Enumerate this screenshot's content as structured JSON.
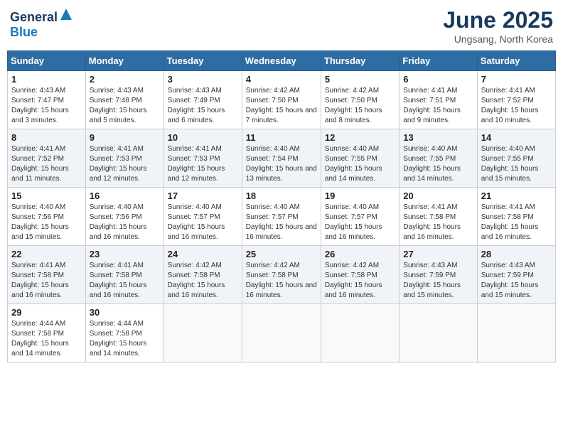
{
  "header": {
    "logo_general": "General",
    "logo_blue": "Blue",
    "month_title": "June 2025",
    "location": "Ungsang, North Korea"
  },
  "days_of_week": [
    "Sunday",
    "Monday",
    "Tuesday",
    "Wednesday",
    "Thursday",
    "Friday",
    "Saturday"
  ],
  "weeks": [
    [
      {
        "day": "1",
        "sunrise": "4:43 AM",
        "sunset": "7:47 PM",
        "daylight": "15 hours and 3 minutes."
      },
      {
        "day": "2",
        "sunrise": "4:43 AM",
        "sunset": "7:48 PM",
        "daylight": "15 hours and 5 minutes."
      },
      {
        "day": "3",
        "sunrise": "4:43 AM",
        "sunset": "7:49 PM",
        "daylight": "15 hours and 6 minutes."
      },
      {
        "day": "4",
        "sunrise": "4:42 AM",
        "sunset": "7:50 PM",
        "daylight": "15 hours and 7 minutes."
      },
      {
        "day": "5",
        "sunrise": "4:42 AM",
        "sunset": "7:50 PM",
        "daylight": "15 hours and 8 minutes."
      },
      {
        "day": "6",
        "sunrise": "4:41 AM",
        "sunset": "7:51 PM",
        "daylight": "15 hours and 9 minutes."
      },
      {
        "day": "7",
        "sunrise": "4:41 AM",
        "sunset": "7:52 PM",
        "daylight": "15 hours and 10 minutes."
      }
    ],
    [
      {
        "day": "8",
        "sunrise": "4:41 AM",
        "sunset": "7:52 PM",
        "daylight": "15 hours and 11 minutes."
      },
      {
        "day": "9",
        "sunrise": "4:41 AM",
        "sunset": "7:53 PM",
        "daylight": "15 hours and 12 minutes."
      },
      {
        "day": "10",
        "sunrise": "4:41 AM",
        "sunset": "7:53 PM",
        "daylight": "15 hours and 12 minutes."
      },
      {
        "day": "11",
        "sunrise": "4:40 AM",
        "sunset": "7:54 PM",
        "daylight": "15 hours and 13 minutes."
      },
      {
        "day": "12",
        "sunrise": "4:40 AM",
        "sunset": "7:55 PM",
        "daylight": "15 hours and 14 minutes."
      },
      {
        "day": "13",
        "sunrise": "4:40 AM",
        "sunset": "7:55 PM",
        "daylight": "15 hours and 14 minutes."
      },
      {
        "day": "14",
        "sunrise": "4:40 AM",
        "sunset": "7:55 PM",
        "daylight": "15 hours and 15 minutes."
      }
    ],
    [
      {
        "day": "15",
        "sunrise": "4:40 AM",
        "sunset": "7:56 PM",
        "daylight": "15 hours and 15 minutes."
      },
      {
        "day": "16",
        "sunrise": "4:40 AM",
        "sunset": "7:56 PM",
        "daylight": "15 hours and 16 minutes."
      },
      {
        "day": "17",
        "sunrise": "4:40 AM",
        "sunset": "7:57 PM",
        "daylight": "15 hours and 16 minutes."
      },
      {
        "day": "18",
        "sunrise": "4:40 AM",
        "sunset": "7:57 PM",
        "daylight": "15 hours and 16 minutes."
      },
      {
        "day": "19",
        "sunrise": "4:40 AM",
        "sunset": "7:57 PM",
        "daylight": "15 hours and 16 minutes."
      },
      {
        "day": "20",
        "sunrise": "4:41 AM",
        "sunset": "7:58 PM",
        "daylight": "15 hours and 16 minutes."
      },
      {
        "day": "21",
        "sunrise": "4:41 AM",
        "sunset": "7:58 PM",
        "daylight": "15 hours and 16 minutes."
      }
    ],
    [
      {
        "day": "22",
        "sunrise": "4:41 AM",
        "sunset": "7:58 PM",
        "daylight": "15 hours and 16 minutes."
      },
      {
        "day": "23",
        "sunrise": "4:41 AM",
        "sunset": "7:58 PM",
        "daylight": "15 hours and 16 minutes."
      },
      {
        "day": "24",
        "sunrise": "4:42 AM",
        "sunset": "7:58 PM",
        "daylight": "15 hours and 16 minutes."
      },
      {
        "day": "25",
        "sunrise": "4:42 AM",
        "sunset": "7:58 PM",
        "daylight": "15 hours and 16 minutes."
      },
      {
        "day": "26",
        "sunrise": "4:42 AM",
        "sunset": "7:58 PM",
        "daylight": "15 hours and 16 minutes."
      },
      {
        "day": "27",
        "sunrise": "4:43 AM",
        "sunset": "7:59 PM",
        "daylight": "15 hours and 15 minutes."
      },
      {
        "day": "28",
        "sunrise": "4:43 AM",
        "sunset": "7:59 PM",
        "daylight": "15 hours and 15 minutes."
      }
    ],
    [
      {
        "day": "29",
        "sunrise": "4:44 AM",
        "sunset": "7:58 PM",
        "daylight": "15 hours and 14 minutes."
      },
      {
        "day": "30",
        "sunrise": "4:44 AM",
        "sunset": "7:58 PM",
        "daylight": "15 hours and 14 minutes."
      },
      null,
      null,
      null,
      null,
      null
    ]
  ]
}
